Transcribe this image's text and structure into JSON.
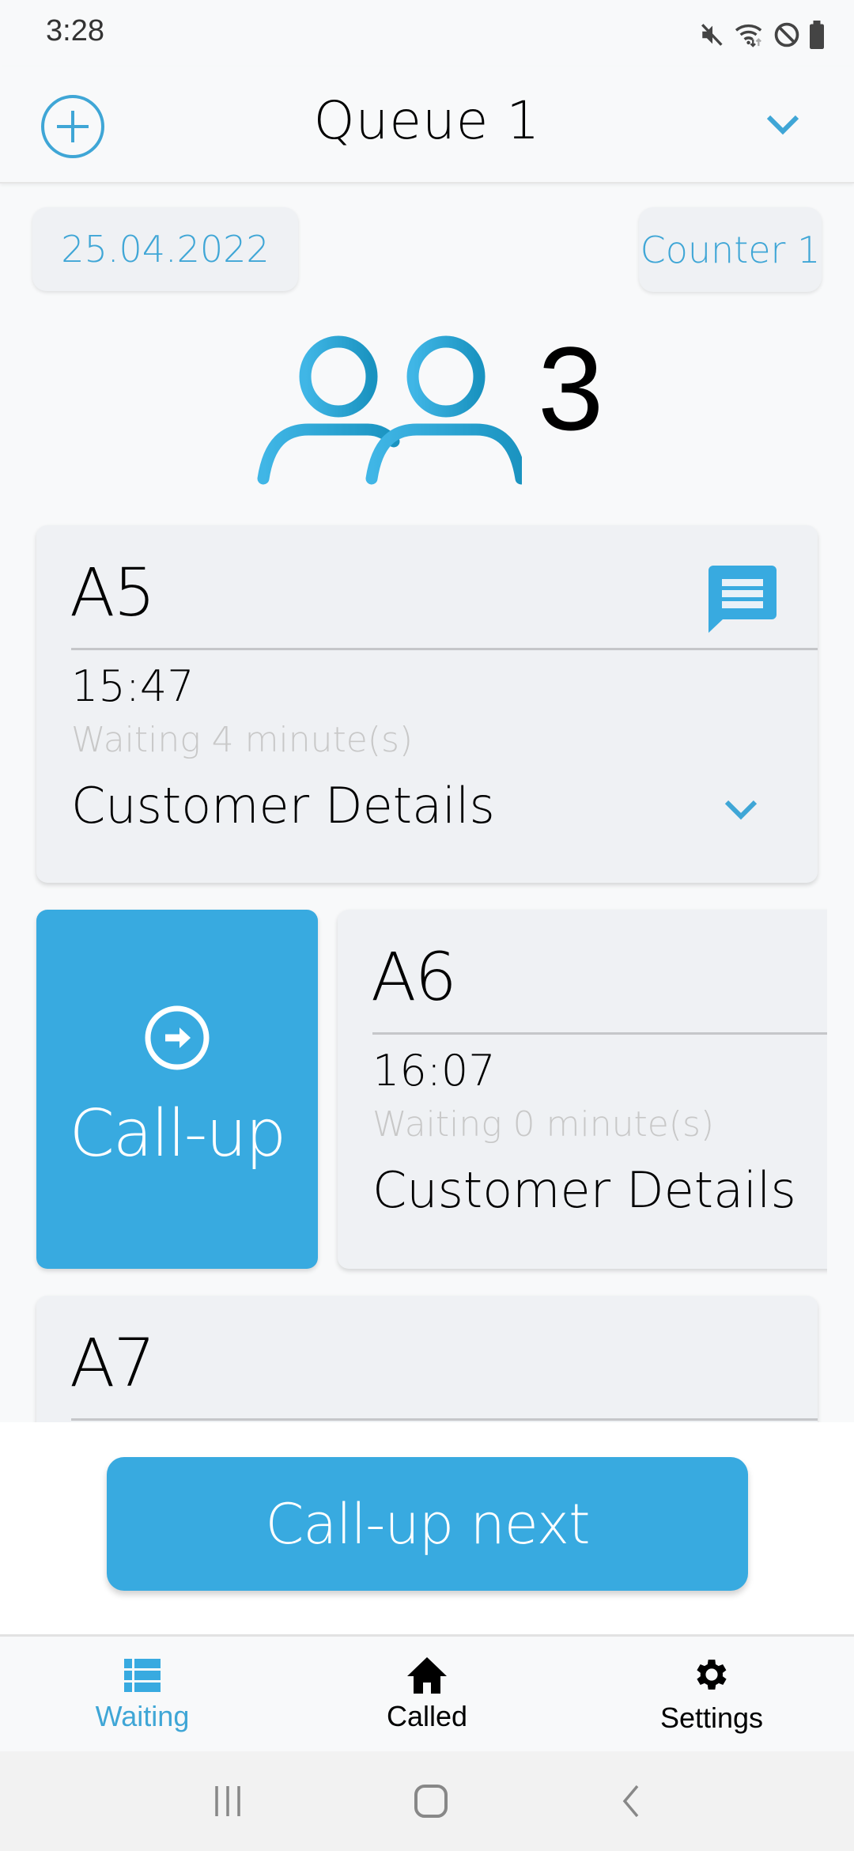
{
  "status_bar": {
    "time": "3:28",
    "icons": [
      "mute-icon",
      "wifi-icon",
      "do-not-disturb-icon",
      "battery-icon"
    ]
  },
  "header": {
    "title": "Queue 1",
    "add_icon": "add-circle-icon",
    "dropdown_icon": "chevron-down-icon"
  },
  "info": {
    "date": "25.04.2022",
    "counter": "Counter 1",
    "waiting_count": "3",
    "people_icon": "people-icon"
  },
  "colors": {
    "accent": "#38aae0",
    "card_bg": "#eff1f4",
    "muted_text": "#c8c8c8"
  },
  "tickets": [
    {
      "id": "A5",
      "time": "15:47",
      "waiting": "Waiting 4 minute(s)",
      "details_label": "Customer Details",
      "has_message": true
    },
    {
      "id": "A6",
      "time": "16:07",
      "waiting": "Waiting 0 minute(s)",
      "details_label": "Customer Details",
      "has_message": false
    },
    {
      "id": "A7"
    }
  ],
  "swipe_action": {
    "label": "Call-up",
    "icon": "arrow-right-circle-icon"
  },
  "primary_action": {
    "label": "Call-up next"
  },
  "bottom_nav": [
    {
      "label": "Waiting",
      "icon": "list-icon",
      "active": true
    },
    {
      "label": "Called",
      "icon": "home-icon",
      "active": false
    },
    {
      "label": "Settings",
      "icon": "gear-icon",
      "active": false
    }
  ],
  "system_nav": [
    "recent-apps-icon",
    "home-button-icon",
    "back-icon"
  ]
}
